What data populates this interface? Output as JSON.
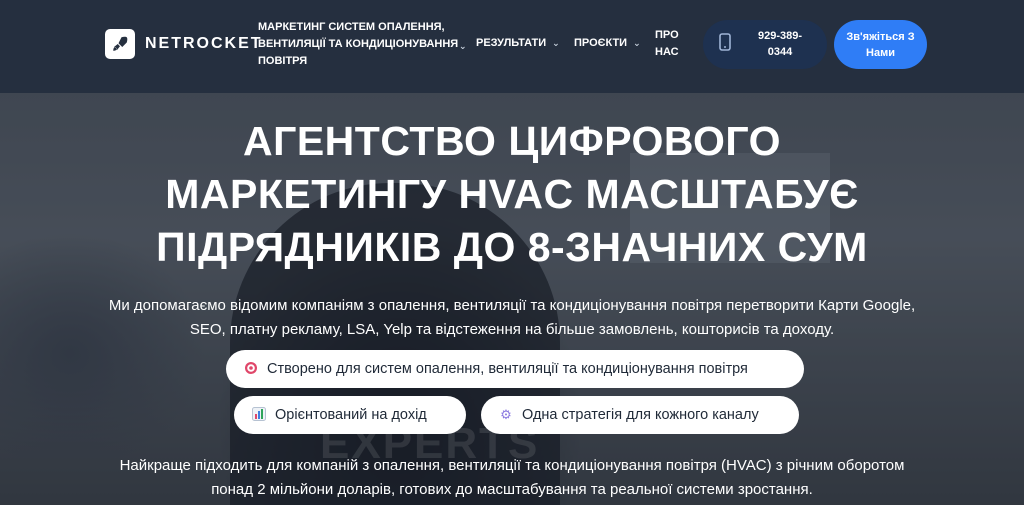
{
  "header": {
    "logo_text": "NETROCKET",
    "nav": {
      "services": "МАРКЕТИНГ СИСТЕМ ОПАЛЕННЯ, ВЕНТИЛЯЦІЇ ТА КОНДИЦІОНУВАННЯ ПОВІТРЯ",
      "results": "РЕЗУЛЬТАТИ",
      "projects": "ПРОЄКТИ",
      "about": "ПРО НАС"
    },
    "phone": "929-389-0344",
    "cta": "Зв'яжіться З Нами"
  },
  "hero": {
    "title": "АГЕНТСТВО ЦИФРОВОГО МАРКЕТИНГУ HVAC МАСШТАБУЄ ПІДРЯДНИКІВ ДО 8-ЗНАЧНИХ СУМ",
    "subtitle": "Ми допомагаємо відомим компаніям з опалення, вентиляції та кондиціонування повітря перетворити Карти Google, SEO, платну рекламу, LSA, Yelp та відстеження на більше замовлень, кошторисів та доходу.",
    "pills": [
      {
        "icon": "target-icon",
        "label": "Створено для систем опалення, вентиляції та кондиціонування повітря"
      },
      {
        "icon": "bar-chart-icon",
        "label": "Орієнтований на дохід"
      },
      {
        "icon": "gear-icon",
        "label": "Одна стратегія для кожного каналу"
      }
    ],
    "note": "Найкраще підходить для компаній з опалення, вентиляції та кондиціонування повітря (HVAC) з річним оборотом понад 2 мільйони доларів, готових до масштабування та реальної системи зростання."
  }
}
